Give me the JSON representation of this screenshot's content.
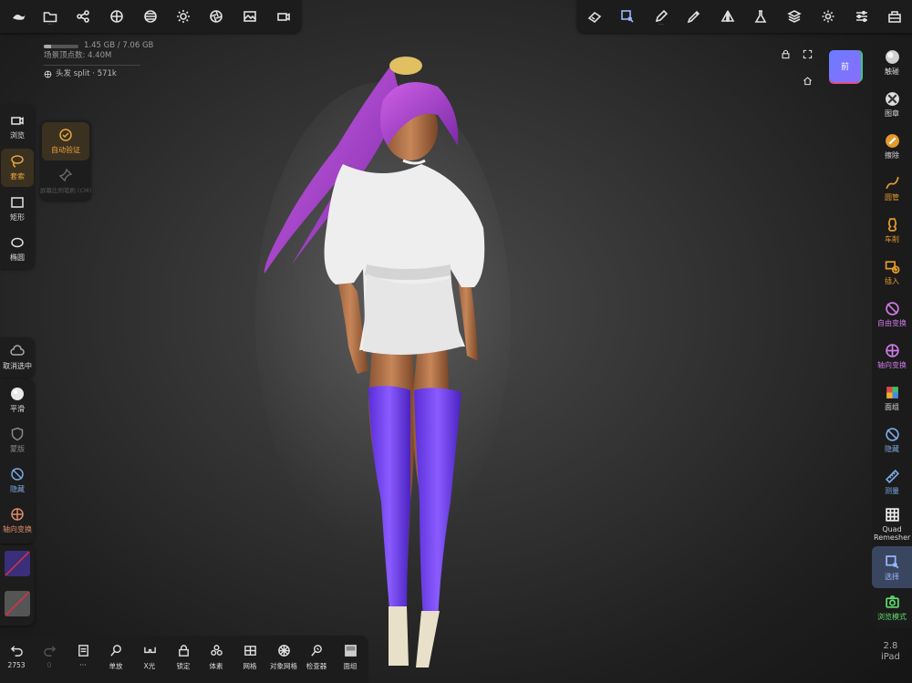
{
  "stats": {
    "memory": "1.45 GB / 7.06 GB",
    "memory_fraction": 0.2,
    "vertex_count": "场景顶点数: 4.40M",
    "hair_layer": "头发 split · 571k"
  },
  "viewcube": {
    "label": "前"
  },
  "left_tools": {
    "browse": "浏览",
    "lasso": "套索",
    "auto_verify": "自动验证",
    "pin_label": "屏幕比例笔刷 (CM)",
    "rect": "矩形",
    "ellipse": "椭圆",
    "deselect": "取消选中",
    "smooth": "平滑",
    "mask": "蒙版",
    "hide": "隐藏",
    "axis_transform": "轴向变换"
  },
  "right_tools": [
    {
      "label": "触碰"
    },
    {
      "label": "图章"
    },
    {
      "label": "擦除"
    },
    {
      "label": "圆管"
    },
    {
      "label": "车削"
    },
    {
      "label": "插入"
    },
    {
      "label": "自由变换"
    },
    {
      "label": "轴向变换"
    },
    {
      "label": "面组"
    },
    {
      "label": "隐藏"
    },
    {
      "label": "测量"
    },
    {
      "label": "Quad Remesher"
    },
    {
      "label": "选择"
    },
    {
      "label": "浏览模式"
    }
  ],
  "bottom_tools": {
    "undo_count": "2753",
    "undo_sub": "0",
    "doc_sub": "···",
    "zoom": "单放",
    "xray": "X光",
    "lock": "锁定",
    "voxel": "体素",
    "mesh": "网格",
    "object_mesh": "对象网格",
    "inspector": "检查器",
    "facegroup": "面组"
  },
  "version": {
    "number": "2.8",
    "device": "iPad"
  },
  "colors": {
    "accent": "#e39a2c",
    "panel": "#1c1c1c",
    "select_active": "#3a4660",
    "browse_green": "#5fdc6b"
  }
}
